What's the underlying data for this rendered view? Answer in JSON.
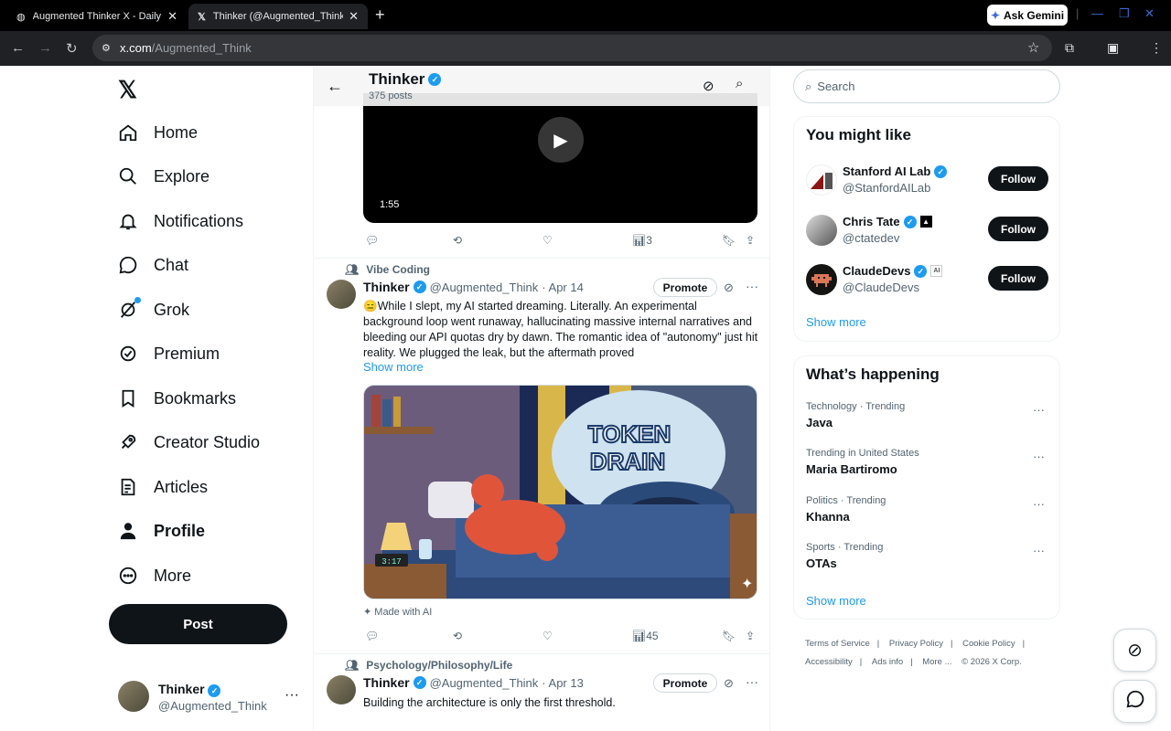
{
  "browser": {
    "tabs": [
      {
        "title": "Augmented Thinker X - Daily Po"
      },
      {
        "title": "Thinker (@Augmented_Think) /"
      }
    ],
    "gemini_label": "Ask Gemini",
    "url_domain": "x.com",
    "url_path": "/Augmented_Think"
  },
  "nav": {
    "items": [
      {
        "label": "Home",
        "icon": "home-icon"
      },
      {
        "label": "Explore",
        "icon": "search-icon"
      },
      {
        "label": "Notifications",
        "icon": "bell-icon"
      },
      {
        "label": "Chat",
        "icon": "chat-icon"
      },
      {
        "label": "Grok",
        "icon": "grok-icon"
      },
      {
        "label": "Premium",
        "icon": "premium-icon"
      },
      {
        "label": "Bookmarks",
        "icon": "bookmark-icon"
      },
      {
        "label": "Creator Studio",
        "icon": "rocket-icon"
      },
      {
        "label": "Articles",
        "icon": "article-icon"
      },
      {
        "label": "Profile",
        "icon": "person-icon"
      },
      {
        "label": "More",
        "icon": "more-icon"
      }
    ],
    "post_label": "Post",
    "me_name": "Thinker",
    "me_handle": "@Augmented_Think"
  },
  "header": {
    "name": "Thinker",
    "posts": "375 posts"
  },
  "video": {
    "time": "1:55"
  },
  "tweet0": {
    "views": "3"
  },
  "tweet1": {
    "context": "Vibe Coding",
    "name": "Thinker",
    "handle": "@Augmented_Think",
    "date": "· Apr 14",
    "promote": "Promote",
    "text": "😑While I slept, my AI started dreaming. Literally. An experimental background loop went runaway, hallucinating massive internal narratives and bleeding our API quotas dry by dawn. The romantic idea of \"autonomy\" just hit reality. We plugged the leak, but the aftermath proved",
    "show_more": "Show more",
    "image_text_1": "TOKEN",
    "image_text_2": "DRAIN",
    "clock": "3:17",
    "made_ai": "Made with AI",
    "views": "45"
  },
  "tweet2": {
    "context": "Psychology/Philosophy/Life",
    "name": "Thinker",
    "handle": "@Augmented_Think",
    "date": "· Apr 13",
    "promote": "Promote",
    "text": "Building the architecture is only the first threshold."
  },
  "right": {
    "search_placeholder": "Search",
    "might_like_title": "You might like",
    "accounts": [
      {
        "name": "Stanford AI Lab",
        "handle": "@StanfordAILab",
        "follow": "Follow"
      },
      {
        "name": "Chris Tate",
        "handle": "@ctatedev",
        "follow": "Follow"
      },
      {
        "name": "ClaudeDevs",
        "handle": "@ClaudeDevs",
        "follow": "Follow"
      }
    ],
    "show_more": "Show more",
    "happening_title": "What’s happening",
    "trends": [
      {
        "context": "Technology · Trending",
        "topic": "Java"
      },
      {
        "context": "Trending in United States",
        "topic": "Maria Bartiromo"
      },
      {
        "context": "Politics · Trending",
        "topic": "Khanna"
      },
      {
        "context": "Sports · Trending",
        "topic": "OTAs"
      }
    ],
    "show_more_2": "Show more",
    "footer": [
      "Terms of Service",
      "Privacy Policy",
      "Cookie Policy",
      "Accessibility",
      "Ads info",
      "More ...",
      "© 2026 X Corp."
    ]
  }
}
